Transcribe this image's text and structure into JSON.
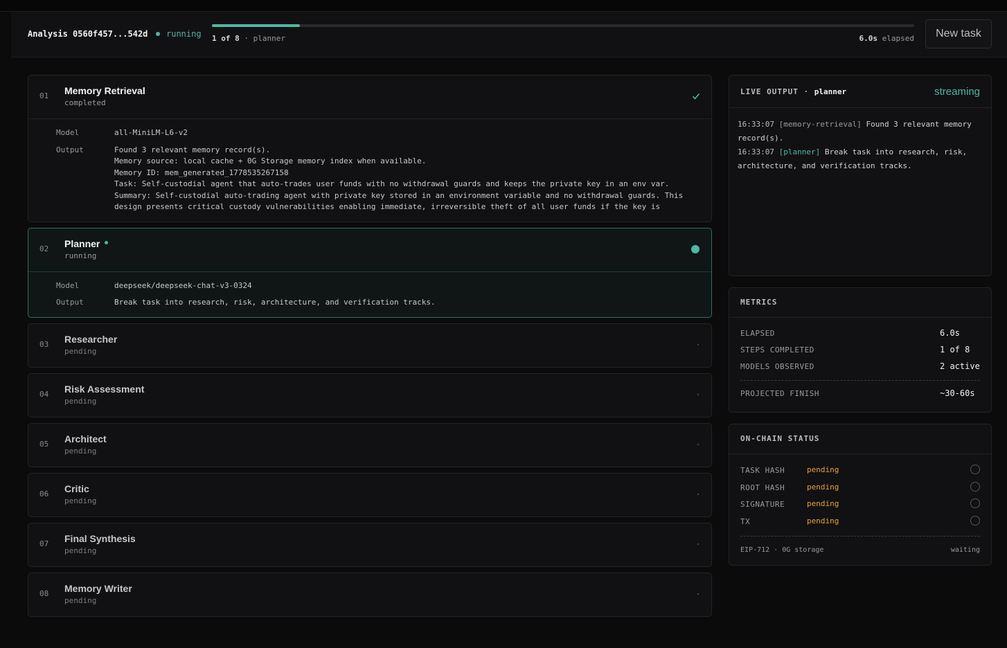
{
  "header": {
    "analysis_label": "Analysis 0560f457...542d",
    "status": "running",
    "step_count": "1 of 8",
    "step_separator": " · ",
    "current_step": "planner",
    "elapsed_value": "6.0s",
    "elapsed_label": " elapsed",
    "progress_fraction": 0.125,
    "new_task_label": "New task"
  },
  "steps": [
    {
      "num": "01",
      "name": "Memory Retrieval",
      "status": "completed",
      "model_label": "Model",
      "model": "all-MiniLM-L6-v2",
      "output_label": "Output",
      "output": "Found 3 relevant memory record(s).\nMemory source: local cache + 0G Storage memory index when available.\nMemory ID: mem_generated_1778535267158\nTask: Self-custodial agent that auto-trades user funds with no withdrawal guards and keeps the private key in an env var.\nSummary: Self-custodial auto-trading agent with private key stored in an environment variable and no withdrawal guards. This\ndesign presents critical custody vulnerabilities enabling immediate, irreversible theft of all user funds if the key is"
    },
    {
      "num": "02",
      "name": "Planner",
      "status": "running",
      "model_label": "Model",
      "model": "deepseek/deepseek-chat-v3-0324",
      "output_label": "Output",
      "output": "Break task into research, risk, architecture, and verification tracks."
    },
    {
      "num": "03",
      "name": "Researcher",
      "status": "pending"
    },
    {
      "num": "04",
      "name": "Risk Assessment",
      "status": "pending"
    },
    {
      "num": "05",
      "name": "Architect",
      "status": "pending"
    },
    {
      "num": "06",
      "name": "Critic",
      "status": "pending"
    },
    {
      "num": "07",
      "name": "Final Synthesis",
      "status": "pending"
    },
    {
      "num": "08",
      "name": "Memory Writer",
      "status": "pending"
    }
  ],
  "live_output": {
    "title": "LIVE OUTPUT",
    "separator": " · ",
    "agent": "planner",
    "state": "streaming",
    "lines": [
      {
        "ts": "16:33:07",
        "tag": "[memory-retrieval]",
        "text": " Found 3 relevant memory record(s)."
      },
      {
        "ts": "16:33:07",
        "tag": "[planner]",
        "text": " Break task into research, risk, architecture, and verification tracks."
      }
    ]
  },
  "metrics": {
    "title": "METRICS",
    "rows": [
      {
        "label": "ELAPSED",
        "value": "6.0s"
      },
      {
        "label": "STEPS COMPLETED",
        "value": "1 of 8"
      },
      {
        "label": "MODELS OBSERVED",
        "value": "2 active"
      }
    ],
    "projected_label": "PROJECTED FINISH",
    "projected_value": "~30-60s"
  },
  "onchain": {
    "title": "ON-CHAIN STATUS",
    "rows": [
      {
        "label": "TASK HASH",
        "value": "pending"
      },
      {
        "label": "ROOT HASH",
        "value": "pending"
      },
      {
        "label": "SIGNATURE",
        "value": "pending"
      },
      {
        "label": "TX",
        "value": "pending"
      }
    ],
    "footer_left": "EIP-712 · 0G storage",
    "footer_right": "waiting"
  },
  "colors": {
    "accent": "#4fb8a4",
    "pending": "#e8a23a",
    "background": "#0b0b0c"
  }
}
